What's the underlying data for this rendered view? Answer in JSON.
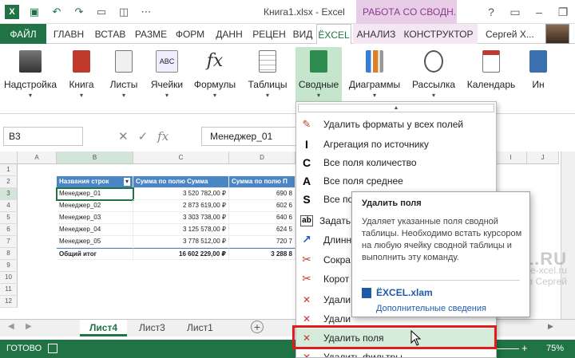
{
  "window": {
    "title": "Книга1.xlsx - Excel",
    "contextual_title": "РАБОТА СО СВОДН...",
    "user": "Сергей Х..."
  },
  "tabs": [
    "ГЛАВН",
    "ВСТАВ",
    "РАЗМЕ",
    "ФОРМ",
    "ДАНН",
    "РЕЦЕН",
    "ВИД",
    "ЁXCEL",
    "АНАЛИЗ",
    "КОНСТРУКТОР"
  ],
  "file_tab": "ФАЙЛ",
  "ribbon": {
    "buttons": [
      "Надстройка",
      "Книга",
      "Листы",
      "Ячейки",
      "Формулы",
      "Таблицы",
      "Сводные",
      "Диаграммы",
      "Рассылка",
      "Календарь",
      "Ин"
    ]
  },
  "formula_bar": {
    "name_box": "B3",
    "fx": "fx",
    "value": "Менеджер_01"
  },
  "grid": {
    "columns": [
      "A",
      "B",
      "C",
      "D",
      "I",
      "J"
    ],
    "rows": [
      "1",
      "2",
      "3",
      "4",
      "5",
      "6",
      "7",
      "8",
      "9",
      "10",
      "11",
      "12"
    ],
    "pivot_headers": [
      "Названия строк",
      "Сумма по полю Сумма",
      "Сумма по полю П"
    ],
    "pivot_rows": [
      {
        "name": "Менеджер_01",
        "sum": "3 520 782,00 ₽",
        "p": "690 8"
      },
      {
        "name": "Менеджер_02",
        "sum": "2 873 619,00 ₽",
        "p": "602 6"
      },
      {
        "name": "Менеджер_03",
        "sum": "3 303 738,00 ₽",
        "p": "640 6"
      },
      {
        "name": "Менеджер_04",
        "sum": "3 125 578,00 ₽",
        "p": "624 5"
      },
      {
        "name": "Менеджер_05",
        "sum": "3 778 512,00 ₽",
        "p": "720 7"
      }
    ],
    "total": {
      "name": "Общий итог",
      "sum": "16 602 229,00 ₽",
      "p": "3 288 8"
    }
  },
  "sheets": [
    "Лист4",
    "Лист3",
    "Лист1"
  ],
  "status": {
    "ready": "ГОТОВО",
    "zoom": "75%"
  },
  "menu": {
    "items": [
      {
        "icon": "eraser-icon",
        "glyph": "✎",
        "label": "Удалить форматы у всех полей"
      },
      {
        "icon": "letter-i-icon",
        "glyph": "I",
        "label": "Агрегация по источнику"
      },
      {
        "icon": "letter-c-icon",
        "glyph": "C",
        "label": "Все поля количество"
      },
      {
        "icon": "letter-a-icon",
        "glyph": "A",
        "label": "Все поля среднее"
      },
      {
        "icon": "letter-s-icon",
        "glyph": "S",
        "label": "Все по"
      },
      {
        "icon": "abl-icon",
        "glyph": "ab",
        "label": "Задать"
      },
      {
        "icon": "ruler-icon",
        "glyph": "↗",
        "label": "Длинн"
      },
      {
        "icon": "scissors-icon",
        "glyph": "✂",
        "label": "Сокра"
      },
      {
        "icon": "scissors-short-icon",
        "glyph": "✂",
        "label": "Корот"
      },
      {
        "icon": "delete-icon",
        "glyph": "✕",
        "label": "Удали"
      },
      {
        "icon": "delete-icon",
        "glyph": "✕",
        "label": "Удали"
      },
      {
        "icon": "delete-fields-icon",
        "glyph": "✕",
        "label": "Удалить поля"
      },
      {
        "icon": "filter-delete-icon",
        "glyph": "✕",
        "label": "Удалить фильтры"
      }
    ]
  },
  "tooltip": {
    "title": "Удалить поля",
    "body": "Удаляет указанные поля сводной таблицы. Необходимо встать курсором на любую ячейку сводной таблицы и выполнить эту команду.",
    "addin": "ЁXCEL.xlam",
    "more": "Дополнительные сведения"
  },
  "watermark": {
    "logo": "EXCEL.RU",
    "site": "www.e-xcel.ru",
    "author": "Хвостов Сергей"
  }
}
